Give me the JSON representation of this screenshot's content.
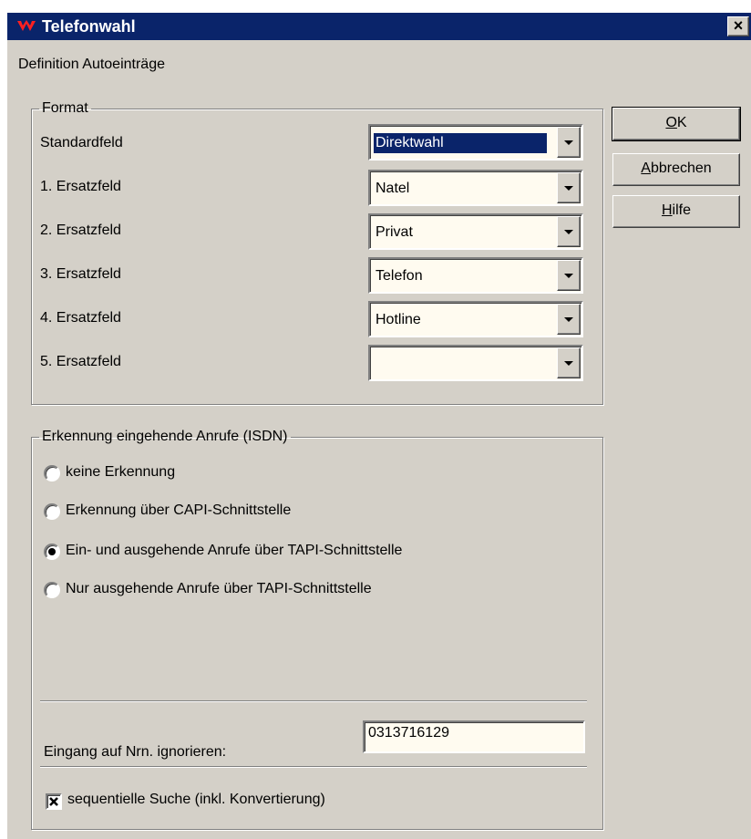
{
  "window": {
    "title": "Telefonwahl",
    "close_label": "×",
    "subtitle": "Definition Autoeinträge"
  },
  "format": {
    "legend": "Format",
    "rows": [
      {
        "label": "Standardfeld",
        "value": "Direktwahl",
        "selected": true
      },
      {
        "label": "1. Ersatzfeld",
        "value": "Natel"
      },
      {
        "label": "2. Ersatzfeld",
        "value": "Privat"
      },
      {
        "label": "3. Ersatzfeld",
        "value": "Telefon"
      },
      {
        "label": "4. Ersatzfeld",
        "value": "Hotline"
      },
      {
        "label": "5. Ersatzfeld",
        "value": ""
      }
    ]
  },
  "buttons": {
    "ok": {
      "pre": "",
      "accel": "O",
      "post": "K"
    },
    "cancel": {
      "pre": "",
      "accel": "A",
      "post": "bbrechen"
    },
    "help": {
      "pre": "",
      "accel": "H",
      "post": "ilfe"
    }
  },
  "isdn": {
    "legend": "Erkennung eingehende Anrufe (ISDN)",
    "options": [
      {
        "label": "keine Erkennung",
        "checked": false
      },
      {
        "label": "Erkennung über CAPI-Schnittstelle",
        "checked": false
      },
      {
        "label": "Ein- und ausgehende Anrufe über TAPI-Schnittstelle",
        "checked": true
      },
      {
        "label": "Nur ausgehende Anrufe über TAPI-Schnittstelle",
        "checked": false
      }
    ],
    "ignore_label": "Eingang auf Nrn. ignorieren:",
    "ignore_value": "0313716129",
    "sequential_label": "sequentielle Suche (inkl. Konvertierung)",
    "sequential_checked": true
  },
  "colors": {
    "titlebar": "#0a246a",
    "face": "#d4d0c8",
    "field_bg": "#fffbf0",
    "selection": "#0a246a"
  }
}
